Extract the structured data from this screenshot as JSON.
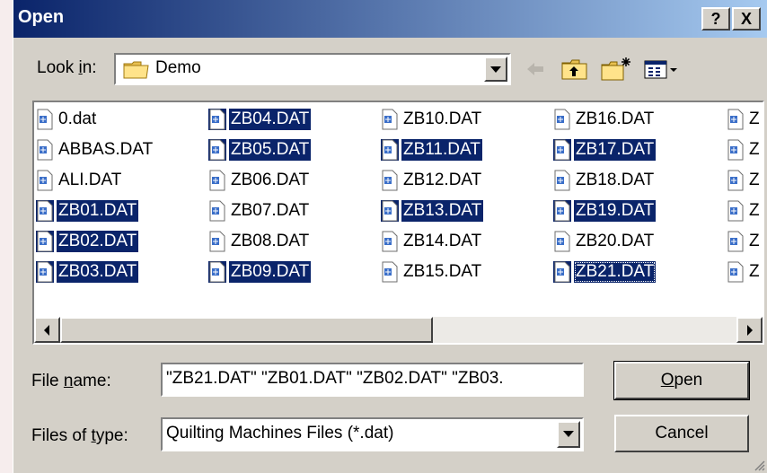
{
  "window": {
    "title": "Open"
  },
  "titlebar_buttons": {
    "help": "?",
    "close": "X"
  },
  "look_in": {
    "label_pre": "Look ",
    "label_key": "i",
    "label_post": "n:",
    "value": "Demo",
    "icon": "folder-icon"
  },
  "toolbar": {
    "icons": [
      "back-arrow-icon",
      "up-folder-icon",
      "new-folder-icon",
      "view-menu-icon"
    ]
  },
  "files": [
    {
      "name": "0.dat",
      "selected": false
    },
    {
      "name": "ABBAS.DAT",
      "selected": false
    },
    {
      "name": "ALI.DAT",
      "selected": false
    },
    {
      "name": "ZB01.DAT",
      "selected": true
    },
    {
      "name": "ZB02.DAT",
      "selected": true
    },
    {
      "name": "ZB03.DAT",
      "selected": true
    },
    {
      "name": "ZB04.DAT",
      "selected": true
    },
    {
      "name": "ZB05.DAT",
      "selected": true
    },
    {
      "name": "ZB06.DAT",
      "selected": false
    },
    {
      "name": "ZB07.DAT",
      "selected": false
    },
    {
      "name": "ZB08.DAT",
      "selected": false
    },
    {
      "name": "ZB09.DAT",
      "selected": true
    },
    {
      "name": "ZB10.DAT",
      "selected": false
    },
    {
      "name": "ZB11.DAT",
      "selected": true
    },
    {
      "name": "ZB12.DAT",
      "selected": false
    },
    {
      "name": "ZB13.DAT",
      "selected": true
    },
    {
      "name": "ZB14.DAT",
      "selected": false
    },
    {
      "name": "ZB15.DAT",
      "selected": false
    },
    {
      "name": "ZB16.DAT",
      "selected": false
    },
    {
      "name": "ZB17.DAT",
      "selected": true
    },
    {
      "name": "ZB18.DAT",
      "selected": false
    },
    {
      "name": "ZB19.DAT",
      "selected": true
    },
    {
      "name": "ZB20.DAT",
      "selected": false
    },
    {
      "name": "ZB21.DAT",
      "selected": true,
      "focused": true
    },
    {
      "name": "Z",
      "selected": false
    },
    {
      "name": "Z",
      "selected": false
    },
    {
      "name": "Z",
      "selected": false
    },
    {
      "name": "Z",
      "selected": false
    },
    {
      "name": "Z",
      "selected": false
    },
    {
      "name": "Z",
      "selected": false
    }
  ],
  "file_name": {
    "label_pre": "File ",
    "label_key": "n",
    "label_post": "ame:",
    "value": "\"ZB21.DAT\" \"ZB01.DAT\" \"ZB02.DAT\" \"ZB03."
  },
  "file_type": {
    "label_pre": "Files of ",
    "label_key": "t",
    "label_post": "ype:",
    "value": "Quilting Machines Files (*.dat)"
  },
  "buttons": {
    "open_key": "O",
    "open_rest": "pen",
    "cancel": "Cancel"
  },
  "colors": {
    "title_start": "#0a246a",
    "title_end": "#a6caf0",
    "selection": "#0a246a",
    "face": "#d4d0c8"
  }
}
